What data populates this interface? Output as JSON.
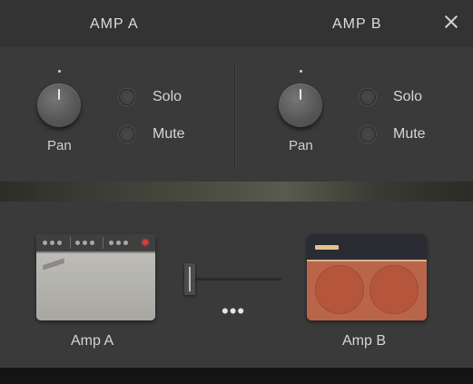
{
  "header": {
    "title_a": "AMP A",
    "title_b": "AMP B",
    "close_icon": "close-icon"
  },
  "channel_a": {
    "pan_label": "Pan",
    "solo_label": "Solo",
    "mute_label": "Mute",
    "pan_value": 0,
    "solo_on": false,
    "mute_on": false
  },
  "channel_b": {
    "pan_label": "Pan",
    "solo_label": "Solo",
    "mute_label": "Mute",
    "pan_value": 0,
    "solo_on": false,
    "mute_on": false
  },
  "blend": {
    "amp_a_label": "Amp A",
    "amp_b_label": "Amp B",
    "crossfade_position": 0.05,
    "more_label": "•••"
  },
  "colors": {
    "panel": "#3a3a3a",
    "header": "#333333",
    "amp_a_body": "#b7b6b1",
    "amp_b_body": "#b8654a",
    "amp_b_speaker": "#b5563c",
    "led": "#e03a3a"
  }
}
